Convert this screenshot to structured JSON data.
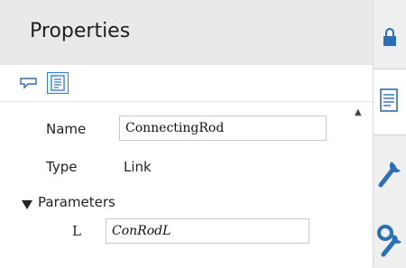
{
  "panel": {
    "title": "Properties"
  },
  "toolbar": {
    "icons": [
      "comment-icon",
      "document-icon"
    ]
  },
  "properties": {
    "name_label": "Name",
    "name_value": "ConnectingRod",
    "type_label": "Type",
    "type_value": "Link",
    "parameters_label": "Parameters",
    "param_l_label": "L",
    "param_l_value": "ConRodL"
  },
  "side_tabs": [
    "lock-icon",
    "document-icon",
    "wrench-icon",
    "gear-wrench-icon"
  ],
  "colors": {
    "header_bg": "#e9e9e9",
    "accent": "#2f7fd8",
    "icon_blue": "#2b6fb5",
    "side_bg": "#efefef"
  }
}
